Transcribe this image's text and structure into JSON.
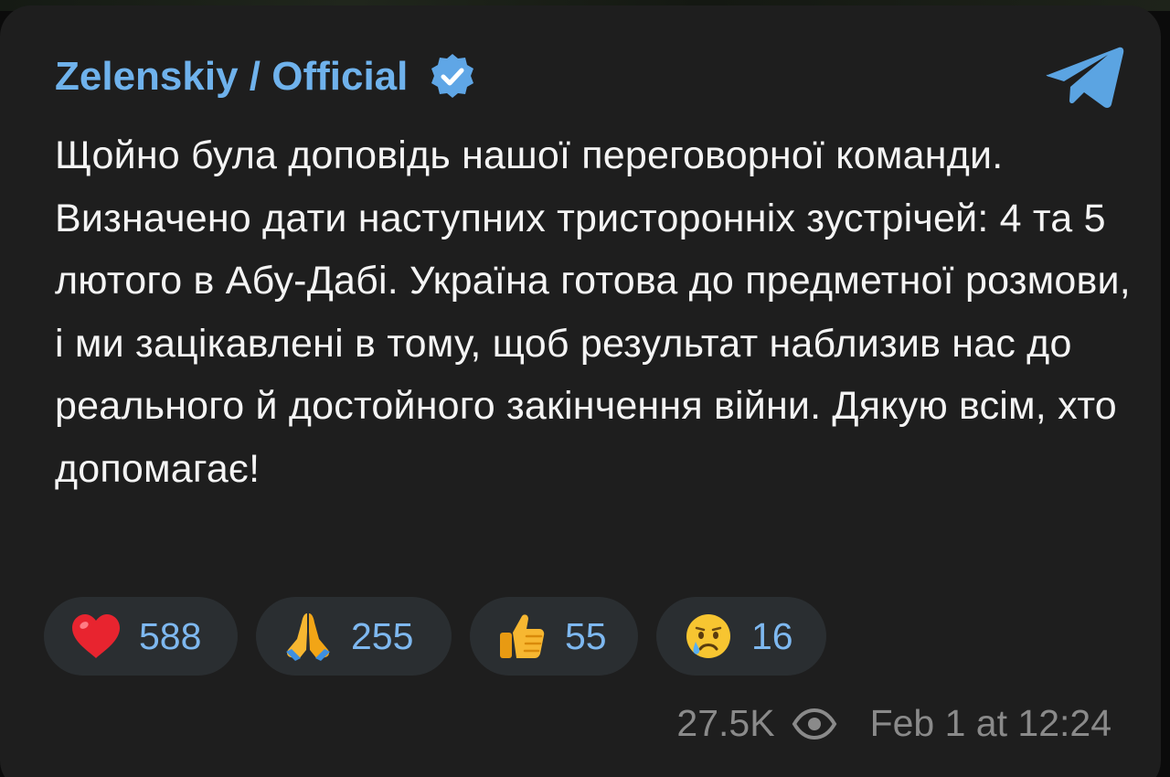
{
  "channel": {
    "name": "Zelenskiy / Official",
    "verified": true
  },
  "message": {
    "text": "Щойно була доповідь нашої переговорної команди. Визначено дати наступних тристоронніх зустрічей: 4 та 5 лютого в Абу-Дабі. Україна готова до предметної розмови, і ми зацікавлені в тому, щоб результат наблизив нас до реального й достойного закінчення війни. Дякую всім, хто допомагає!"
  },
  "reactions": [
    {
      "emoji": "heart",
      "count": "588"
    },
    {
      "emoji": "folded-hands",
      "count": "255"
    },
    {
      "emoji": "thumbs-up",
      "count": "55"
    },
    {
      "emoji": "crying-face",
      "count": "16"
    }
  ],
  "meta": {
    "views": "27.5K",
    "timestamp": "Feb 1 at 12:24"
  },
  "colors": {
    "accent": "#6fb2ec",
    "bubble": "#1e1e1e",
    "reaction_bg": "#2a2e31",
    "text": "#f4f4f4",
    "muted": "#8a8a8a"
  }
}
